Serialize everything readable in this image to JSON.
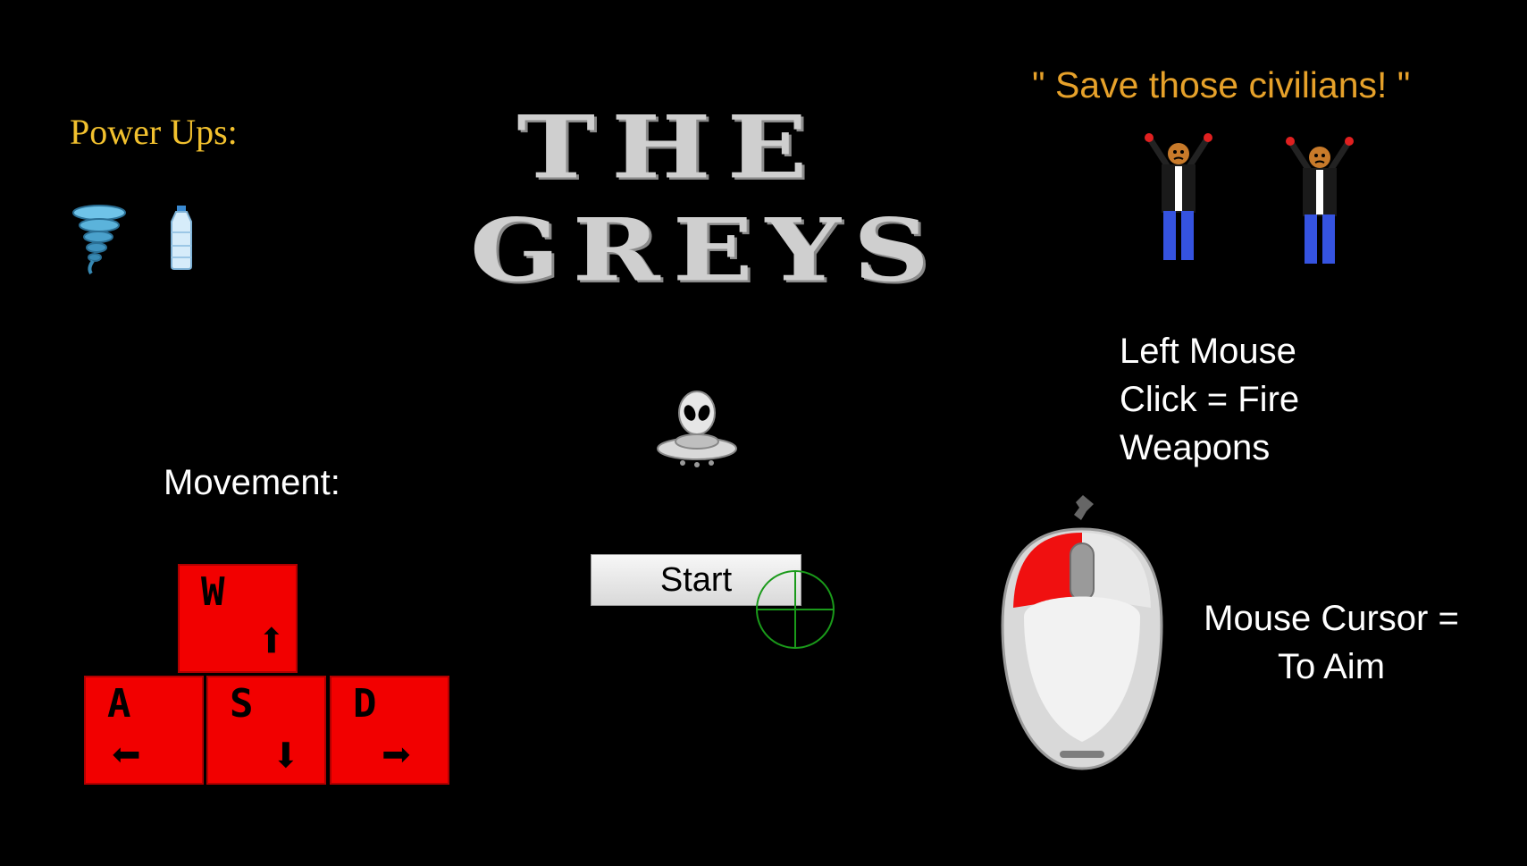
{
  "title": {
    "line1": "THE",
    "line2": "GREYS"
  },
  "powerups": {
    "label": "Power Ups:",
    "items": [
      {
        "icon": "tornado-icon"
      },
      {
        "icon": "water-bottle-icon"
      }
    ]
  },
  "quote": "\" Save those civilians! \"",
  "civilians": [
    {
      "icon": "civilian-figure-icon"
    },
    {
      "icon": "civilian-figure-icon"
    }
  ],
  "fire": {
    "lines": [
      "Left Mouse",
      "Click = Fire",
      "Weapons"
    ]
  },
  "movement": {
    "label": "Movement:",
    "keys": [
      {
        "letter": "W",
        "arrow": "⬆"
      },
      {
        "letter": "A",
        "arrow": "⬅"
      },
      {
        "letter": "S",
        "arrow": "⬇"
      },
      {
        "letter": "D",
        "arrow": "➡"
      }
    ]
  },
  "start_button": {
    "label": "Start"
  },
  "aim": {
    "lines": [
      "Mouse Cursor =",
      "To Aim"
    ]
  },
  "colors": {
    "background": "#000000",
    "powerups_label": "#f2c12e",
    "quote": "#e6a12a",
    "key_red": "#f20000",
    "title_grey": "#cfcfcf",
    "crosshair_green": "#1a9a1a"
  }
}
